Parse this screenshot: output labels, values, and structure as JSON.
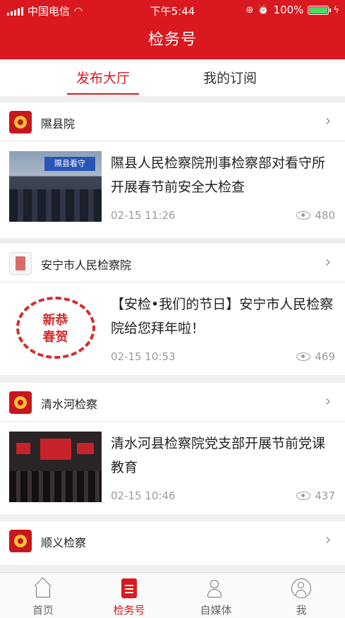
{
  "status_bar": {
    "carrier": "中国电信",
    "time": "下午5:44",
    "battery": "100%",
    "battery_level": 1.0
  },
  "nav": {
    "title": "检务号"
  },
  "tabs": [
    {
      "label": "发布大厅",
      "active": true
    },
    {
      "label": "我的订阅",
      "active": false
    }
  ],
  "feed": [
    {
      "source": "隰县院",
      "headline": "隰县人民检察院刑事检察部对看守所开展春节前安全大检查",
      "time": "02-15 11:26",
      "views": "480",
      "thumb_sign": "隰县看守"
    },
    {
      "source": "安宁市人民检察院",
      "headline": "【安检•我们的节日】安宁市人民检察院给您拜年啦！",
      "time": "02-15 10:53",
      "views": "469",
      "thumb_text": "新恭\n春贺"
    },
    {
      "source": "清水河检察",
      "headline": "清水河县检察院党支部开展节前党课教育",
      "time": "02-15 10:46",
      "views": "437"
    },
    {
      "source": "顺义检察"
    }
  ],
  "tabbar": [
    {
      "label": "首页",
      "icon": "home-icon"
    },
    {
      "label": "检务号",
      "icon": "document-icon",
      "active": true
    },
    {
      "label": "自媒体",
      "icon": "media-icon"
    },
    {
      "label": "我",
      "icon": "profile-icon"
    }
  ],
  "colors": {
    "brand": "#d9191f",
    "meta": "#9a9a9a"
  }
}
